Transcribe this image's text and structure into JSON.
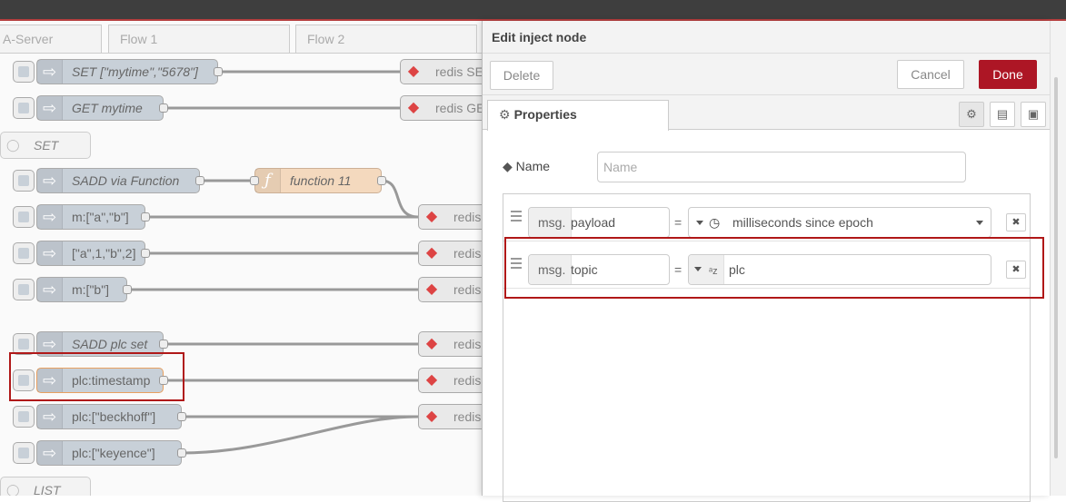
{
  "workspace": {
    "tabs": [
      "A-Server",
      "Flow 1",
      "Flow 2"
    ],
    "nodes": [
      {
        "label": "SET [\"mytime\",\"5678\"]",
        "italic": true
      },
      {
        "label": "GET mytime",
        "italic": true
      },
      {
        "label": "SADD via Function",
        "italic": true
      },
      {
        "label": "m:[\"a\",\"b\"]",
        "italic": false
      },
      {
        "label": "[\"a\",1,\"b\",2]",
        "italic": false
      },
      {
        "label": "m:[\"b\"]",
        "italic": false
      },
      {
        "label": "SADD plc set",
        "italic": true
      },
      {
        "label": "plc:timestamp",
        "italic": false
      },
      {
        "label": "plc:[\"beckhoff\"]",
        "italic": false
      },
      {
        "label": "plc:[\"keyence\"]",
        "italic": false
      }
    ],
    "function_node": "function 11",
    "comments": [
      "SET",
      "LIST"
    ],
    "redis_labels": [
      "redis SET",
      "redis GET",
      "redis",
      "redis",
      "redis",
      "redis",
      "redis",
      "redis"
    ]
  },
  "editor": {
    "title": "Edit inject node",
    "delete_label": "Delete",
    "cancel_label": "Cancel",
    "done_label": "Done",
    "properties_tab": "Properties",
    "name_label": "Name",
    "name_placeholder": "Name",
    "rows": [
      {
        "prefix": "msg.",
        "property": "payload",
        "type_icon": "clock-icon",
        "value": "milliseconds since epoch",
        "has_dropdown": true
      },
      {
        "prefix": "msg.",
        "property": "topic",
        "type_icon": "string-type-icon",
        "value": "plc",
        "has_dropdown": false
      }
    ],
    "equals": "="
  },
  "colors": {
    "accent": "#ad1625",
    "highlight": "#b01818",
    "inject_node": "#c8d0d8",
    "function_node": "#f4d9be"
  }
}
